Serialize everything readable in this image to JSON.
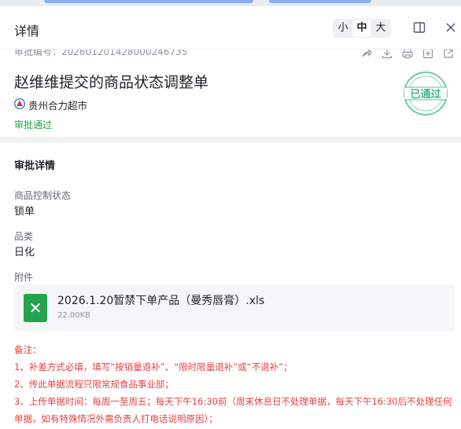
{
  "header": {
    "title": "详情",
    "font_sizes": [
      "小",
      "中",
      "大"
    ],
    "active_size": "中",
    "icons": [
      "split-view-icon",
      "close-icon"
    ]
  },
  "summary": {
    "serial_label": "审批编号：",
    "serial_no": "202601201428000246735",
    "title": "赵维维提交的商品状态调整单",
    "org": "贵州合力超市",
    "status": "审批通过",
    "stamp_text": "已通过",
    "status_color": "#2ba44a",
    "actions": [
      "share-icon",
      "download-icon",
      "print-icon",
      "add-icon",
      "export-icon"
    ]
  },
  "details": {
    "section_title": "审批详情",
    "fields": [
      {
        "label": "商品控制状态",
        "value": "锁单"
      },
      {
        "label": "品类",
        "value": "日化"
      }
    ],
    "attachment": {
      "label": "附件",
      "file_name": "2026.1.20暂禁下单产品（曼秀唇膏）.xls",
      "file_size": "22.00KB",
      "file_icon": "excel-file-icon",
      "file_color": "#23a34e"
    },
    "note": {
      "title": "备注：",
      "lines": [
        "1、补差方式必填，填写“按销量退补”、“限时限量退补”或“不退补”；",
        "2、传此单据流程只限常规食品事业部；",
        "3、上传单据时间：每周一至周五；每天下午16:30前（周末休息日不处理单据，每天下午16:30后不处理任何单据，如有特殊情况外需负责人打电话说明原因）；"
      ],
      "color": "#e83f3f"
    }
  },
  "colors": {
    "accent": "#3a78f2",
    "text": "#1f2329",
    "muted": "#8f959e"
  }
}
